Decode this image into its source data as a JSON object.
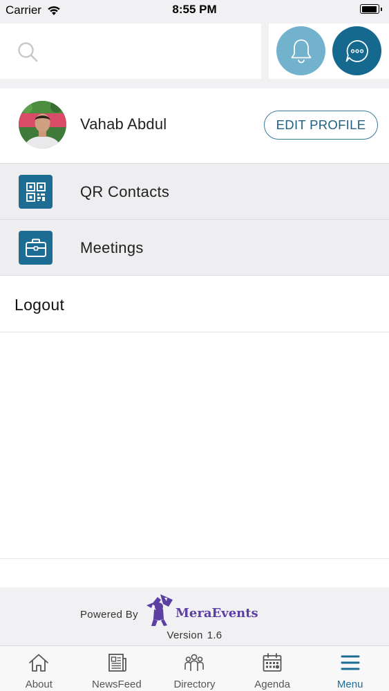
{
  "status_bar": {
    "carrier": "Carrier",
    "time": "8:55 PM"
  },
  "header": {
    "search_icon": "search-icon",
    "bell_icon": "bell-icon",
    "chat_icon": "chat-bubble-icon"
  },
  "profile": {
    "name": "Vahab Abdul",
    "edit_label": "EDIT PROFILE"
  },
  "menu": {
    "items": [
      {
        "label": "QR Contacts",
        "icon": "qr-code-icon"
      },
      {
        "label": "Meetings",
        "icon": "briefcase-icon"
      }
    ],
    "logout_label": "Logout"
  },
  "footer": {
    "powered_by": "Powered By",
    "brand": "MeraEvents",
    "version_label": "Version",
    "version_value": "1.6"
  },
  "tabs": [
    {
      "label": "About",
      "icon": "home-icon"
    },
    {
      "label": "NewsFeed",
      "icon": "newspaper-icon"
    },
    {
      "label": "Directory",
      "icon": "people-icon"
    },
    {
      "label": "Agenda",
      "icon": "calendar-icon"
    },
    {
      "label": "Menu",
      "icon": "hamburger-menu-icon"
    }
  ],
  "colors": {
    "accent": "#1c6c93",
    "bell_bg": "#73b2cc",
    "brand": "#5b3fa3"
  }
}
